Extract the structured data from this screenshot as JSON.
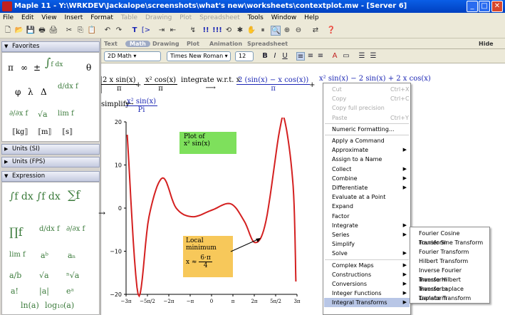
{
  "window": {
    "title": "Maple 11 - Y:\\WRKDEV\\Jackalope\\screenshots\\what's new\\worksheets\\contextplot.mw - [Server 6]"
  },
  "menubar": [
    "File",
    "Edit",
    "View",
    "Insert",
    "Format",
    "Table",
    "Drawing",
    "Plot",
    "Spreadsheet",
    "Tools",
    "Window",
    "Help"
  ],
  "palette": {
    "favorites": "Favorites",
    "units_si": "Units (SI)",
    "units_fps": "Units (FPS)",
    "expression": "Expression",
    "fav_symbols": [
      "π",
      "∞",
      "±",
      "θ",
      "φ",
      "λ",
      "Δ",
      "⟦kg⟧",
      "⟦m⟧",
      "⟦s⟧"
    ]
  },
  "context_tabs": {
    "text": "Text",
    "math": "Math",
    "drawing": "Drawing",
    "plot": "Plot",
    "animation": "Animation",
    "spreadsheet": "Spreadsheet",
    "hide": "Hide"
  },
  "format": {
    "mode": "2D Math",
    "font": "Times New Roman",
    "size": "12",
    "bold": "B",
    "italic": "I",
    "underline": "U"
  },
  "doc": {
    "expr1_num": "2 x sin(x)",
    "expr1_den": "π",
    "expr2_num": "x² cos(x)",
    "expr2_den": "π",
    "arrow_label": "integrate w.r.t. x",
    "result_num": "2 (sin(x) − x cos(x))",
    "result_den": "π",
    "result_tail": "x² sin(x) − 2 sin(x) + 2 x cos(x)",
    "simplify_label": "simplify",
    "simp_num": "x² sin(x)",
    "simp_den": "Pi",
    "plot_title_1": "Plot of",
    "plot_title_2": "x² sin(x)",
    "annot_1": "Local minimum",
    "annot_x": "x ≈",
    "annot_num": "6·π",
    "annot_den": "4",
    "input_arrow": "→"
  },
  "chart_data": {
    "type": "line",
    "title": "Plot of x² sin(x)",
    "xlabel": "",
    "ylabel": "",
    "xticks": [
      "−3π",
      "−5π/2",
      "−2π",
      "−π",
      "0",
      "π",
      "2π",
      "5π/2",
      "3π"
    ],
    "yticks": [
      "20",
      "10",
      "0",
      "−10",
      "−20"
    ],
    "xlim": [
      -3.142,
      3.142
    ],
    "ylim": [
      -20,
      20
    ],
    "series": [
      {
        "values": [
          [
            -3.1,
            17
          ],
          [
            -2.7,
            -20
          ],
          [
            -2.3,
            -2
          ],
          [
            -1.8,
            7
          ],
          [
            -1.3,
            0
          ],
          [
            -0.7,
            -2
          ],
          [
            0,
            -0.5
          ],
          [
            0.7,
            1
          ],
          [
            1.2,
            -3
          ],
          [
            1.6,
            -8
          ],
          [
            2.0,
            -3
          ],
          [
            2.5,
            18
          ],
          [
            2.7,
            20
          ],
          [
            3.0,
            5
          ],
          [
            3.1,
            -17
          ]
        ]
      }
    ]
  },
  "context_menu": [
    {
      "label": "Cut",
      "shortcut": "Ctrl+X",
      "disabled": true
    },
    {
      "label": "Copy",
      "shortcut": "Ctrl+C",
      "disabled": true
    },
    {
      "label": "Copy full precision",
      "disabled": true
    },
    {
      "label": "Paste",
      "shortcut": "Ctrl+Y",
      "disabled": true
    },
    {
      "label": "Numeric Formatting..."
    },
    {
      "label": "Apply a Command"
    },
    {
      "label": "Approximate",
      "sub": true
    },
    {
      "label": "Assign to a Name"
    },
    {
      "label": "Collect",
      "sub": true
    },
    {
      "label": "Combine",
      "sub": true
    },
    {
      "label": "Differentiate",
      "sub": true
    },
    {
      "label": "Evaluate at a Point"
    },
    {
      "label": "Expand"
    },
    {
      "label": "Factor"
    },
    {
      "label": "Integrate",
      "sub": true
    },
    {
      "label": "Series",
      "sub": true
    },
    {
      "label": "Simplify"
    },
    {
      "label": "Solve",
      "sub": true
    },
    {
      "label": "Complex Maps",
      "sub": true
    },
    {
      "label": "Constructions",
      "sub": true
    },
    {
      "label": "Conversions",
      "sub": true
    },
    {
      "label": "Integer Functions",
      "sub": true
    },
    {
      "label": "Integral Transforms",
      "sub": true,
      "selected": true
    }
  ],
  "submenu": [
    "Fourier Cosine Transform",
    "Fourier Sine Transform",
    "Fourier Transform",
    "Hilbert Transform",
    "Inverse Fourier Transform",
    "Inverse Hilbert Transform",
    "Inverse Laplace Transform",
    "Laplace Transform"
  ]
}
